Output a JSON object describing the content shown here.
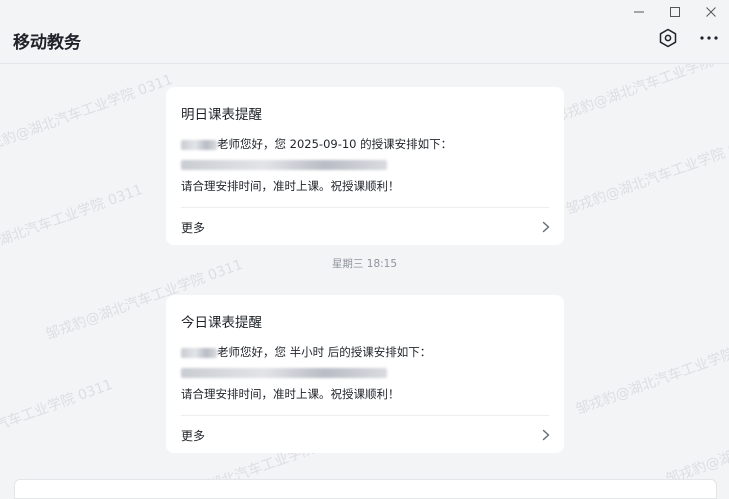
{
  "app": {
    "title": "移动教务"
  },
  "window_controls": [
    "minimize-icon",
    "maximize-icon",
    "close-icon"
  ],
  "header_icons": [
    "settings-hexagon-icon",
    "more-icon"
  ],
  "watermark": {
    "text": "邹戎豹@湖北汽车工业学院 0311"
  },
  "cards": [
    {
      "title": "明日课表提醒",
      "greeting_suffix": "老师您好，您 2025-09-10 的授课安排如下：",
      "closing": "请合理安排时间，准时上课。祝授课顺利！",
      "more_label": "更多"
    },
    {
      "title": "今日课表提醒",
      "greeting_suffix": "老师您好，您 半小时 后的授课安排如下：",
      "closing": "请合理安排时间，准时上课。祝授课顺利！",
      "more_label": "更多"
    }
  ],
  "timestamp": "星期三 18:15"
}
